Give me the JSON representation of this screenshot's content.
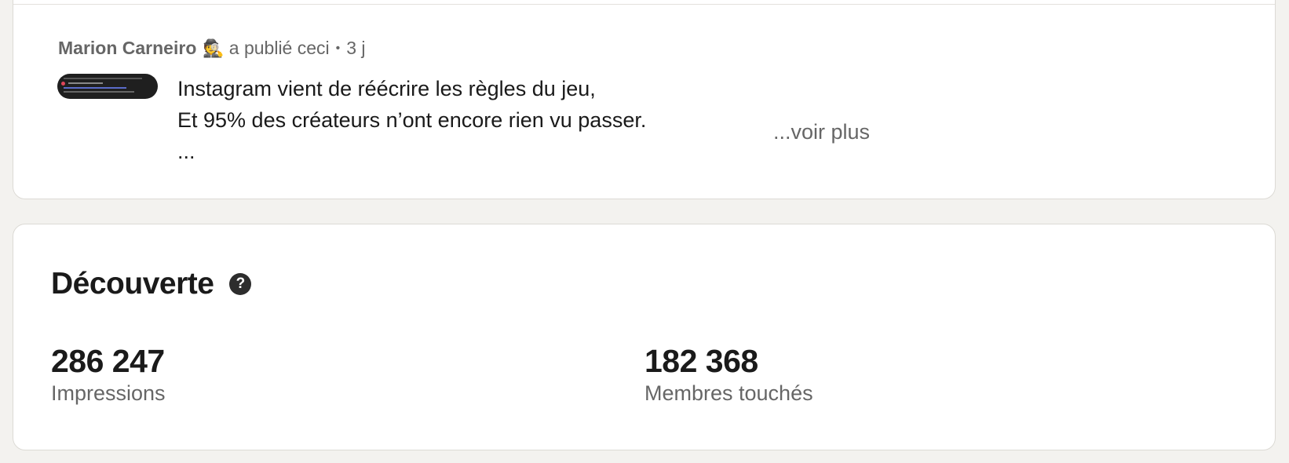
{
  "post": {
    "author": "Marion Carneiro",
    "author_emoji": "🕵️",
    "action": "a publié ceci",
    "separator": "•",
    "age": "3 j",
    "lines": [
      "Instagram vient de réécrire les règles du jeu,",
      "Et 95% des créateurs n’ont encore rien vu passer.",
      "..."
    ],
    "see_more": "...voir plus"
  },
  "discovery": {
    "title": "Découverte",
    "help_icon": "question-icon",
    "stats": [
      {
        "value": "286 247",
        "label": "Impressions"
      },
      {
        "value": "182 368",
        "label": "Membres touchés"
      }
    ]
  }
}
